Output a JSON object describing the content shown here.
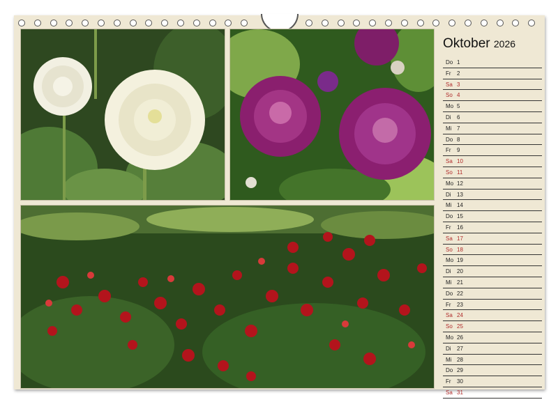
{
  "calendar": {
    "month": "Oktober",
    "year": "2026",
    "days": [
      {
        "d": "Do",
        "n": "1",
        "we": false
      },
      {
        "d": "Fr",
        "n": "2",
        "we": false
      },
      {
        "d": "Sa",
        "n": "3",
        "we": true
      },
      {
        "d": "So",
        "n": "4",
        "we": true
      },
      {
        "d": "Mo",
        "n": "5",
        "we": false
      },
      {
        "d": "Di",
        "n": "6",
        "we": false
      },
      {
        "d": "Mi",
        "n": "7",
        "we": false
      },
      {
        "d": "Do",
        "n": "8",
        "we": false
      },
      {
        "d": "Fr",
        "n": "9",
        "we": false
      },
      {
        "d": "Sa",
        "n": "10",
        "we": true
      },
      {
        "d": "So",
        "n": "11",
        "we": true
      },
      {
        "d": "Mo",
        "n": "12",
        "we": false
      },
      {
        "d": "Di",
        "n": "13",
        "we": false
      },
      {
        "d": "Mi",
        "n": "14",
        "we": false
      },
      {
        "d": "Do",
        "n": "15",
        "we": false
      },
      {
        "d": "Fr",
        "n": "16",
        "we": false
      },
      {
        "d": "Sa",
        "n": "17",
        "we": true
      },
      {
        "d": "So",
        "n": "18",
        "we": true
      },
      {
        "d": "Mo",
        "n": "19",
        "we": false
      },
      {
        "d": "Di",
        "n": "20",
        "we": false
      },
      {
        "d": "Mi",
        "n": "21",
        "we": false
      },
      {
        "d": "Do",
        "n": "22",
        "we": false
      },
      {
        "d": "Fr",
        "n": "23",
        "we": false
      },
      {
        "d": "Sa",
        "n": "24",
        "we": true
      },
      {
        "d": "So",
        "n": "25",
        "we": true
      },
      {
        "d": "Mo",
        "n": "26",
        "we": false
      },
      {
        "d": "Di",
        "n": "27",
        "we": false
      },
      {
        "d": "Mi",
        "n": "28",
        "we": false
      },
      {
        "d": "Do",
        "n": "29",
        "we": false
      },
      {
        "d": "Fr",
        "n": "30",
        "we": false
      },
      {
        "d": "Sa",
        "n": "31",
        "we": true
      }
    ]
  },
  "colors": {
    "paper": "#efe8d4",
    "weekend": "#b02a2a",
    "text": "#222222"
  }
}
